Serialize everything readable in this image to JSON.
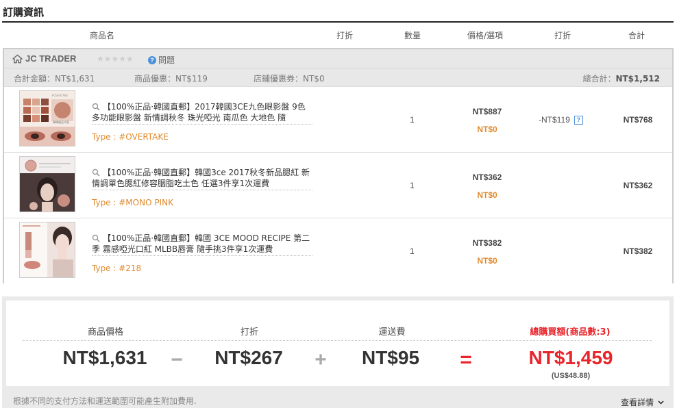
{
  "section_title": "訂購資訊",
  "columns": {
    "product": "商品名",
    "discount1": "打折",
    "quantity": "數量",
    "price_option": "價格/選項",
    "discount2": "打折",
    "total": "合計"
  },
  "shop": {
    "name": "JC TRADER",
    "question_label": "問題",
    "rating_stars": "★★★★★",
    "subtotal": "合計金額：NT$1,631",
    "product_discount": "商品優惠：NT$119",
    "coupon": "店鋪優惠券：NT$0",
    "grand_total_label": "總合計：",
    "grand_total_value": "NT$1,512"
  },
  "items": [
    {
      "title": "【100%正品·韓國直郵】2017韓國3CE九色眼影盤 9色多功能眼影盤 新情調秋冬 珠光啞光 南瓜色 大地色 隨",
      "type": "Type : #OVERTAKE",
      "quantity": "1",
      "price": "NT$887",
      "price_option": "NT$0",
      "discount": "-NT$119",
      "discount_help": "?",
      "total": "NT$768",
      "thumb_label": "#OVERTAKE",
      "thumb_caption": "韓韓國品代直"
    },
    {
      "title": "【100%正品·韓國直郵】韓國3ce 2017秋冬新品腮紅 新情調單色腮紅修容胭脂吃土色 任選3件享1次運費",
      "type": "Type : #MONO PINK",
      "quantity": "1",
      "price": "NT$362",
      "price_option": "NT$0",
      "discount": "",
      "total": "NT$362",
      "thumb_label": ""
    },
    {
      "title": "【100%正品·韓國直郵】韓國 3CE MOOD RECIPE 第二季 霧感啞光口紅 MLBB唇膏 隨手挑3件享1次運費",
      "type": "Type : #218",
      "quantity": "1",
      "price": "NT$382",
      "price_option": "NT$0",
      "discount": "",
      "total": "NT$382",
      "thumb_label": ""
    }
  ],
  "summary": {
    "product_price_label": "商品價格",
    "product_price": "NT$1,631",
    "minus": "−",
    "discount_label": "打折",
    "discount": "NT$267",
    "plus": "+",
    "shipping_label": "運送費",
    "shipping": "NT$95",
    "equals": "=",
    "total_label": "總購買額(商品數:3)",
    "total": "NT$1,459",
    "total_usd": "(US$48.88)"
  },
  "footnote": "根據不同的支付方法和運送範圍可能產生附加費用.",
  "detail_link": "查看詳情",
  "colors": {
    "accent_orange": "#e08a2e",
    "total_red": "#e8252b",
    "help_blue": "#4a90d9"
  }
}
